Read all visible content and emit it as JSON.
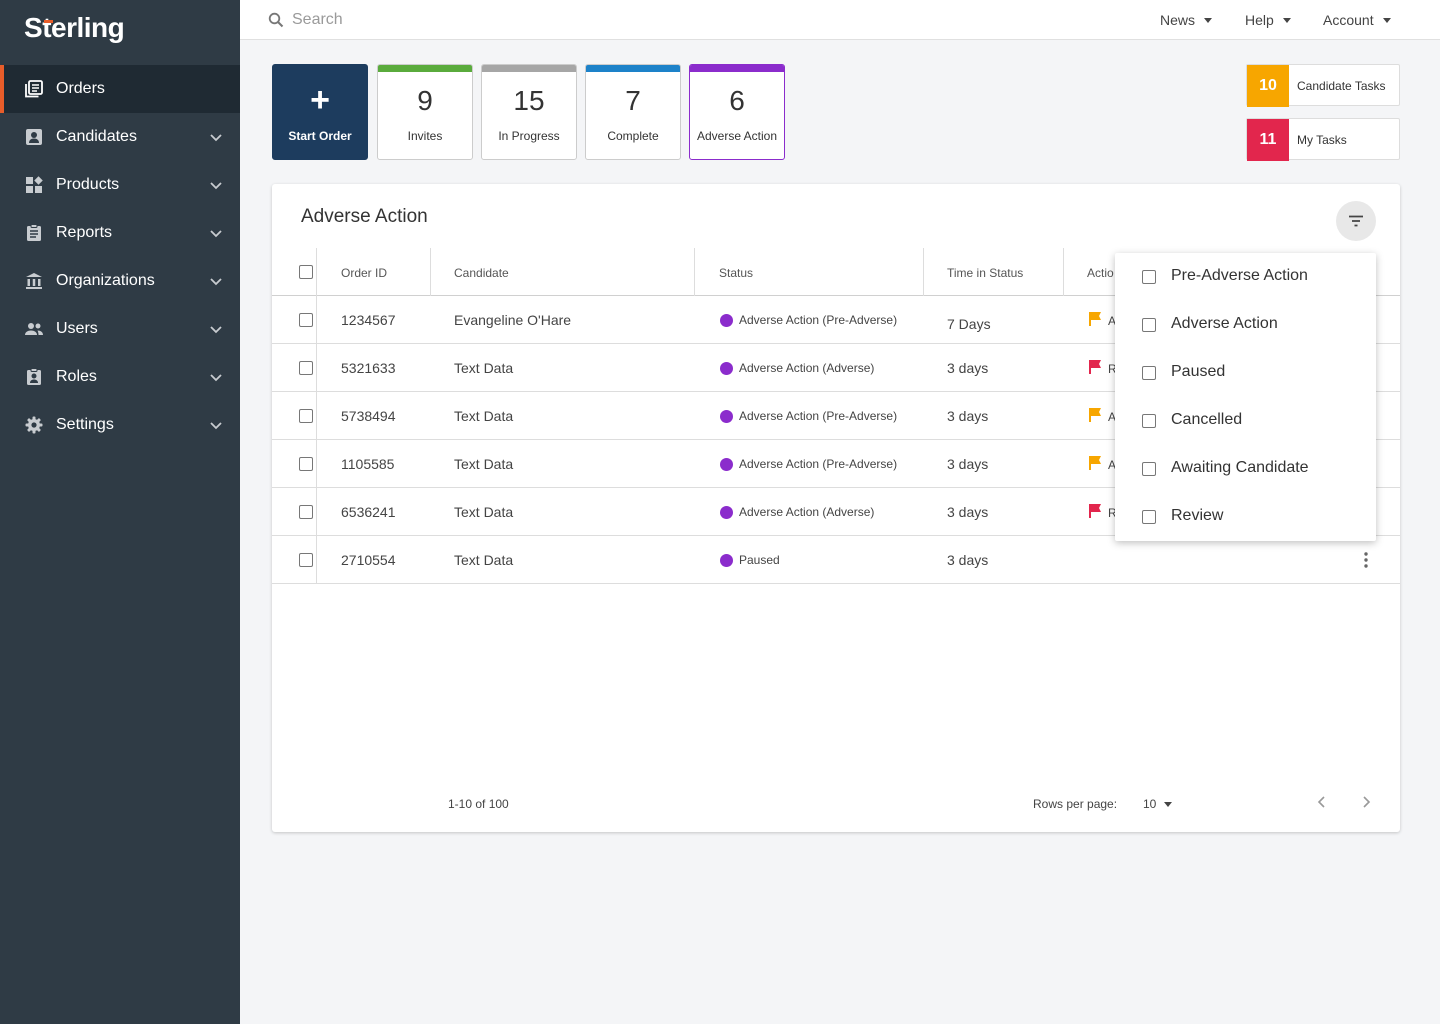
{
  "brand": {
    "logo_pre": "S",
    "logo_accent": "t",
    "logo_post": "erling"
  },
  "sidebar": {
    "items": [
      {
        "label": "Orders",
        "icon": "orders-icon",
        "active": true
      },
      {
        "label": "Candidates",
        "icon": "candidates-icon"
      },
      {
        "label": "Products",
        "icon": "products-icon"
      },
      {
        "label": "Reports",
        "icon": "reports-icon"
      },
      {
        "label": "Organizations",
        "icon": "organizations-icon"
      },
      {
        "label": "Users",
        "icon": "users-icon"
      },
      {
        "label": "Roles",
        "icon": "roles-icon"
      },
      {
        "label": "Settings",
        "icon": "gear-icon"
      }
    ]
  },
  "topbar": {
    "search_placeholder": "Search",
    "news": "News",
    "help": "Help",
    "account": "Account"
  },
  "tiles": {
    "start": "Start Order",
    "start_glyph": "+",
    "invites": {
      "count": "9",
      "label": "Invites",
      "color": "#5aab3c"
    },
    "in_progress": {
      "count": "15",
      "label": "In Progress",
      "color": "#a6a6a6"
    },
    "complete": {
      "count": "7",
      "label": "Complete",
      "color": "#1d82c9"
    },
    "adverse": {
      "count": "6",
      "label": "Adverse Action",
      "color": "#8b2ccc"
    }
  },
  "tasks": {
    "candidate": {
      "count": "10",
      "label": "Candidate Tasks",
      "color": "#f7a600"
    },
    "mine": {
      "count": "11",
      "label": "My Tasks",
      "color": "#e2264d"
    }
  },
  "card": {
    "title": "Adverse Action",
    "columns": {
      "order_id": "Order ID",
      "candidate": "Candidate",
      "status": "Status",
      "time": "Time in Status",
      "action": "Actio"
    },
    "rows": [
      {
        "id": "1234567",
        "candidate": "Evangeline O'Hare",
        "status": "Adverse Action (Pre-Adverse)",
        "time": "7 Days",
        "flag": "A",
        "flag_color": "#f7a600"
      },
      {
        "id": "5321633",
        "candidate": "Text Data",
        "status": "Adverse Action (Adverse)",
        "time": "3 days",
        "flag": "R",
        "flag_color": "#e2264d"
      },
      {
        "id": "5738494",
        "candidate": "Text Data",
        "status": "Adverse Action (Pre-Adverse)",
        "time": "3 days",
        "flag": "A",
        "flag_color": "#f7a600"
      },
      {
        "id": "1105585",
        "candidate": "Text Data",
        "status": "Adverse Action (Pre-Adverse)",
        "time": "3 days",
        "flag": "A",
        "flag_color": "#f7a600"
      },
      {
        "id": "6536241",
        "candidate": "Text Data",
        "status": "Adverse Action (Adverse)",
        "time": "3 days",
        "flag": "R",
        "flag_color": "#e2264d"
      },
      {
        "id": "2710554",
        "candidate": "Text Data",
        "status": "Paused",
        "time": "3 days",
        "flag": "",
        "flag_color": ""
      }
    ],
    "pagination": {
      "range": "1-10 of 100",
      "rows_label": "Rows per page:",
      "rows_value": "10"
    }
  },
  "filter_menu": {
    "options": [
      "Pre-Adverse Action",
      "Adverse Action",
      "Paused",
      "Cancelled",
      "Awaiting Candidate",
      "Review"
    ]
  }
}
